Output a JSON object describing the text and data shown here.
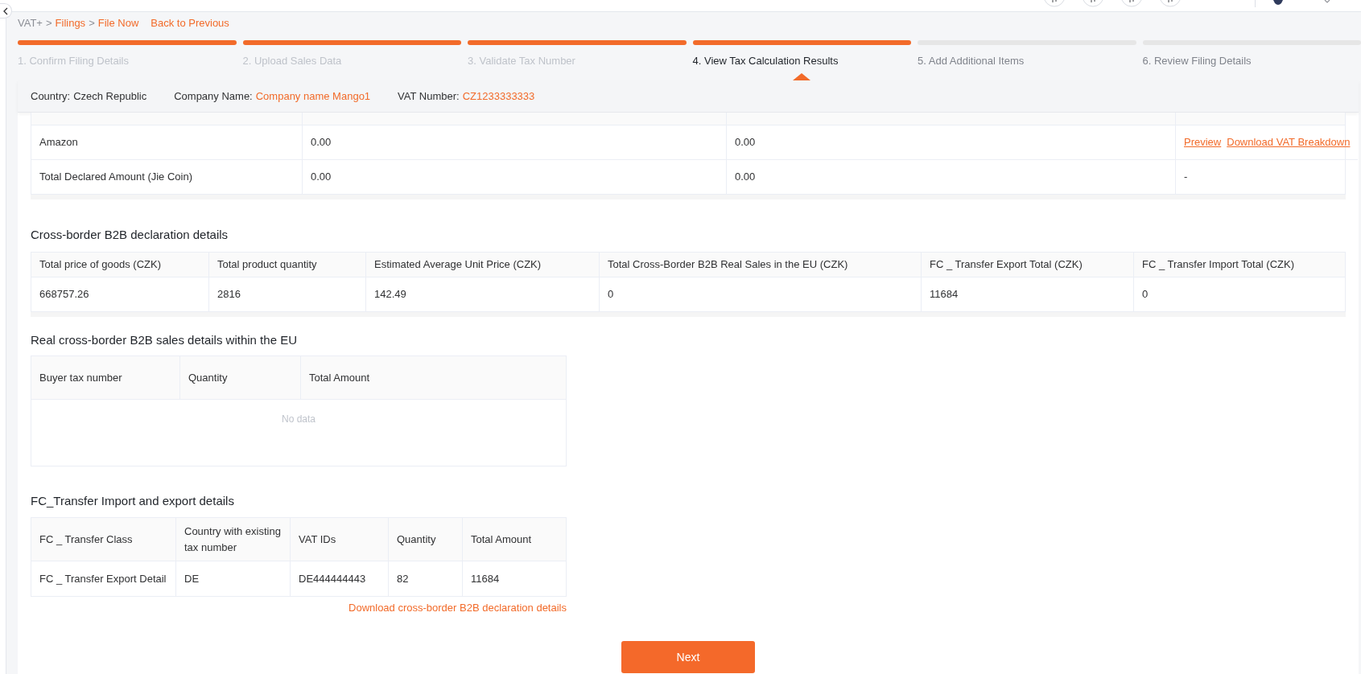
{
  "breadcrumb": {
    "items": [
      {
        "label": "VAT+",
        "link": false
      },
      {
        "label": "Filings",
        "link": true
      },
      {
        "label": "File Now",
        "link": true
      }
    ],
    "separator": ">",
    "back_link": "Back to Previous"
  },
  "steps": [
    {
      "label": "1. Confirm Filing Details",
      "done": true,
      "selected": false
    },
    {
      "label": "2. Upload Sales Data",
      "done": true,
      "selected": false
    },
    {
      "label": "3. Validate Tax Number",
      "done": true,
      "selected": false
    },
    {
      "label": "4. View Tax Calculation Results",
      "done": true,
      "selected": true
    },
    {
      "label": "5. Add Additional Items",
      "done": false,
      "selected": false
    },
    {
      "label": "6. Review Filing Details",
      "done": false,
      "selected": false
    }
  ],
  "filing_info": [
    {
      "label": "Country:",
      "value": "Czech Republic",
      "highlight": false
    },
    {
      "label": "Company Name:",
      "value": "Company name Mango1",
      "highlight": true
    },
    {
      "label": "VAT Number:",
      "value": "CZ1233333333",
      "highlight": true
    }
  ],
  "sales_table": {
    "rows": [
      {
        "cells": [
          {
            "kind": "text",
            "text": "Amazon"
          },
          {
            "kind": "text",
            "text": "0.00"
          },
          {
            "kind": "text",
            "text": "0.00"
          },
          {
            "kind": "links",
            "links": [
              "Preview",
              "Download VAT Breakdown"
            ]
          }
        ]
      },
      {
        "cells": [
          {
            "kind": "text",
            "text": "Total Declared Amount (Jie Coin)"
          },
          {
            "kind": "text",
            "text": "0.00"
          },
          {
            "kind": "text",
            "text": "0.00"
          },
          {
            "kind": "text",
            "text": "-"
          }
        ]
      }
    ]
  },
  "b2b_declaration": {
    "title": "Cross-border B2B declaration details",
    "columns": [
      "Total price of goods (CZK)",
      "Total product quantity",
      "Estimated Average Unit Price (CZK)",
      "Total Cross-Border B2B Real Sales in the EU (CZK)",
      "FC _ Transfer Export Total (CZK)",
      "FC _ Transfer Import Total (CZK)"
    ],
    "rows": [
      [
        "668757.26",
        "2816",
        "142.49",
        "0",
        "11684",
        "0"
      ]
    ]
  },
  "eu_sales": {
    "title": "Real cross-border B2B sales details within the EU",
    "columns": [
      "Buyer tax number",
      "Quantity",
      "Total Amount"
    ],
    "empty_text": "No data"
  },
  "fc_transfer": {
    "title": "FC_Transfer Import and export details",
    "columns": [
      "FC _ Transfer Class",
      "Country with existing tax number",
      "VAT IDs",
      "Quantity",
      "Total Amount"
    ],
    "rows": [
      [
        "FC _ Transfer Export Detail",
        "DE",
        "DE444444443",
        "82",
        "11684"
      ]
    ],
    "download_link": "Download cross-border B2B declaration details"
  },
  "next_button": "Next"
}
